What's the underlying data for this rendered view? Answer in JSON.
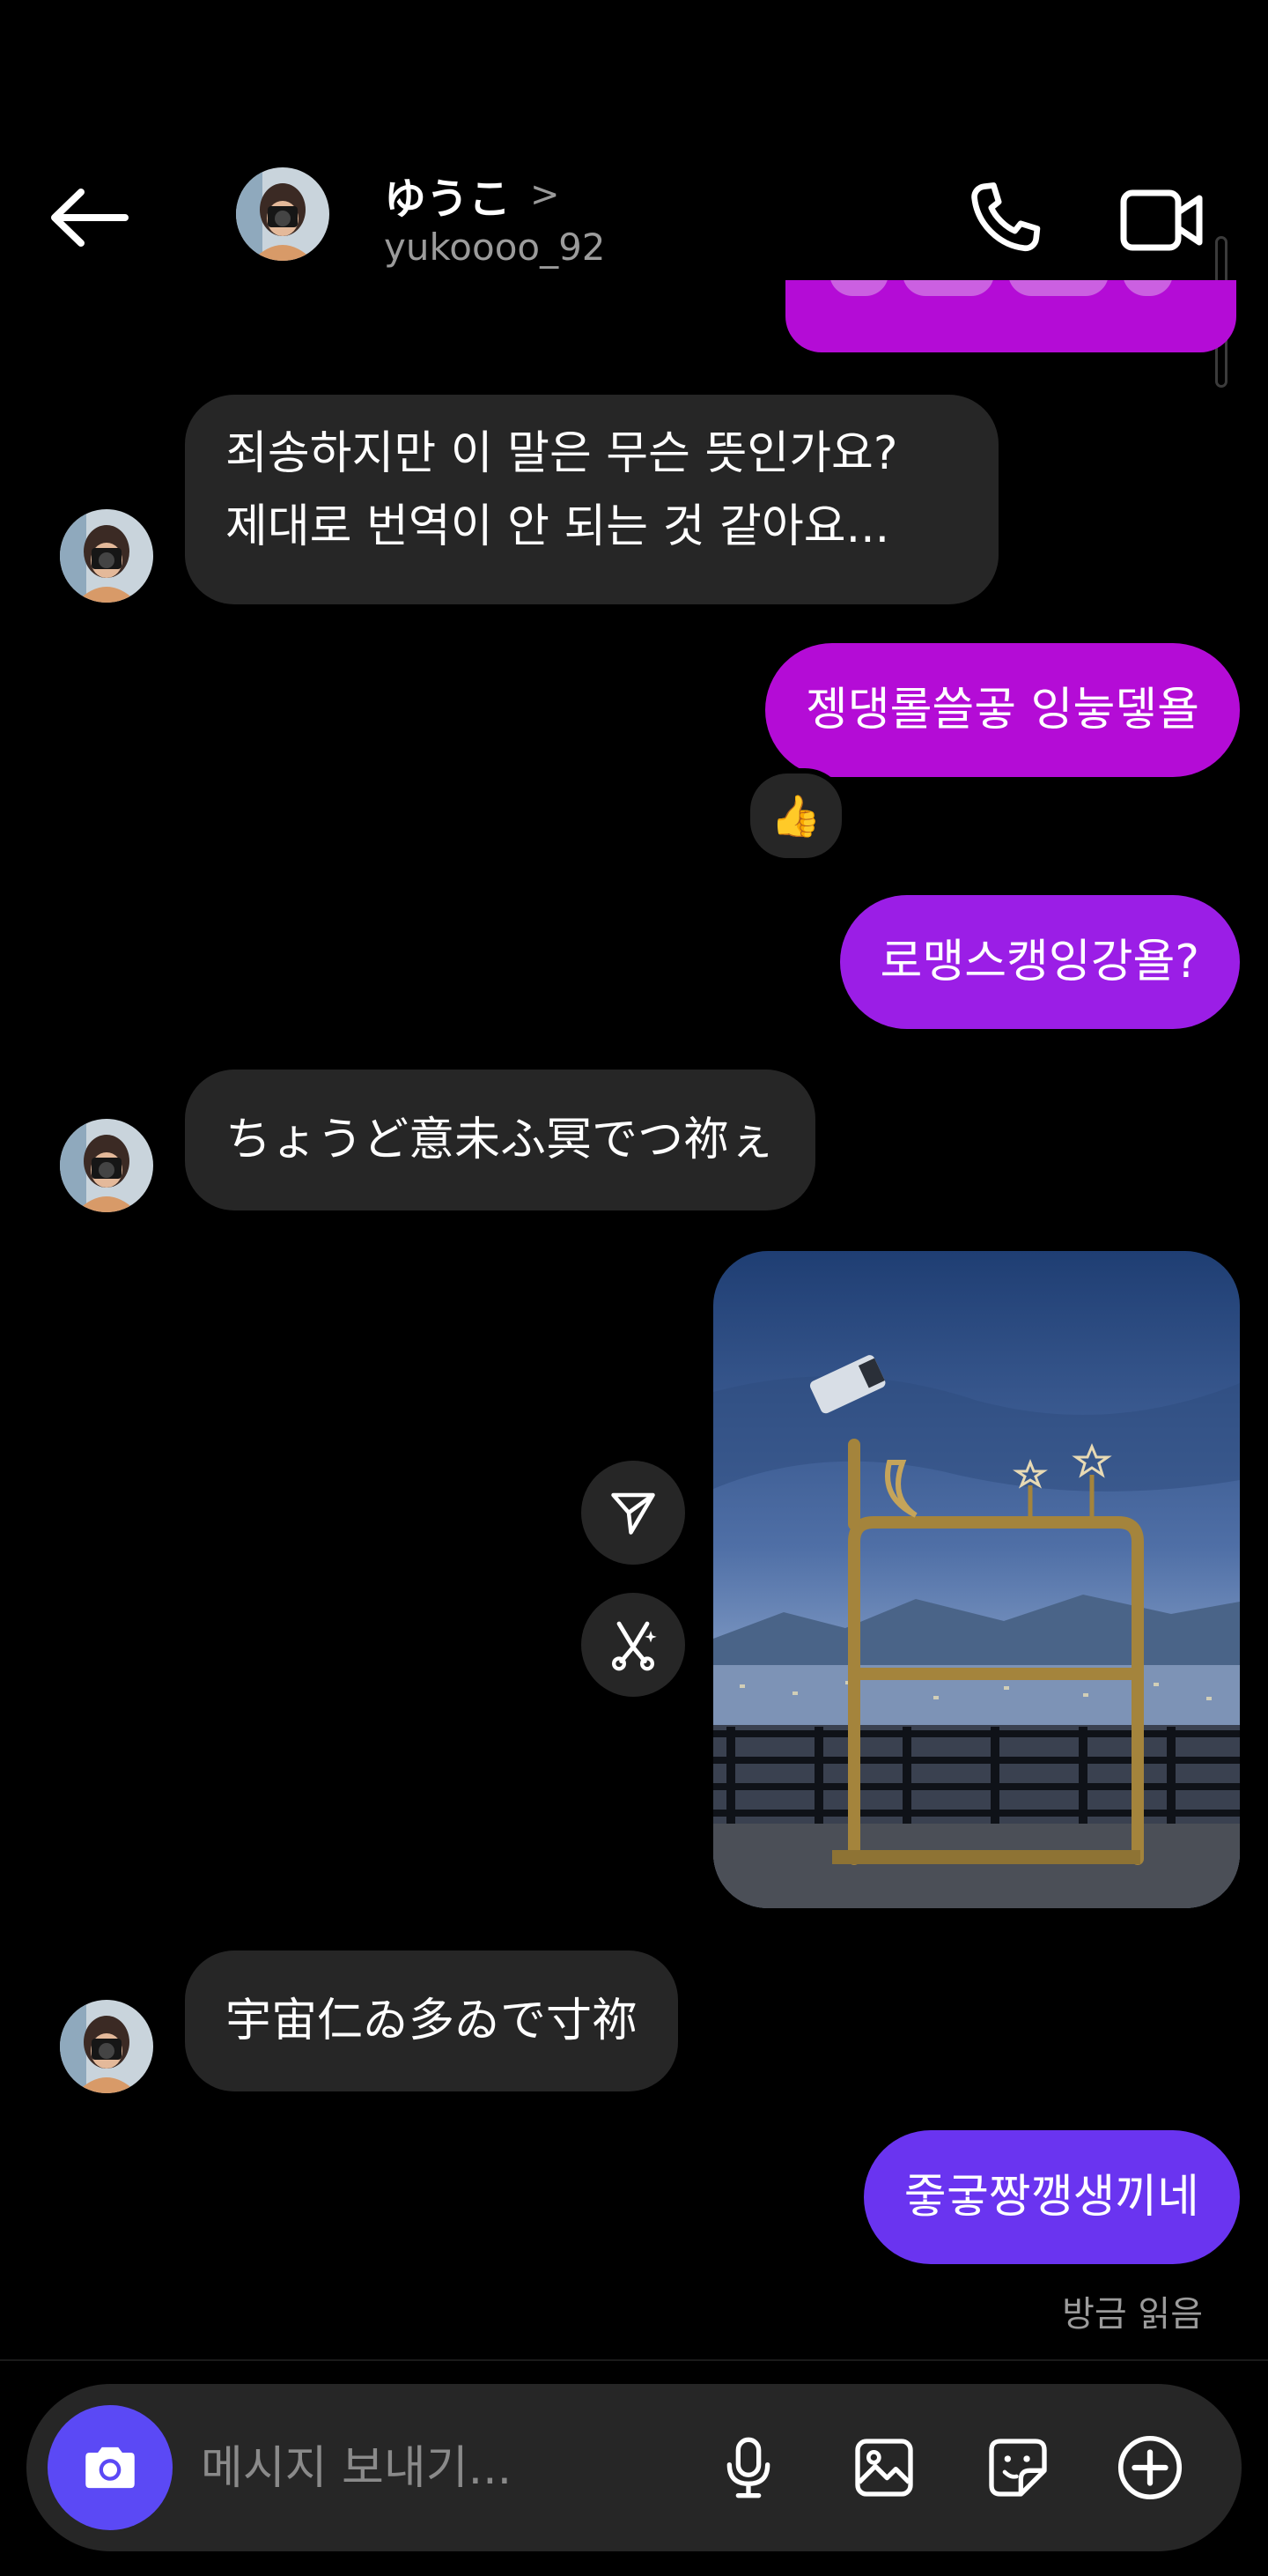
{
  "header": {
    "display_name": "ゆうこ",
    "chevron": ">",
    "username": "yukoooo_92"
  },
  "messages": {
    "m1": {
      "line1": "죄송하지만 이 말은 무슨 뜻인가요?",
      "line2": "제대로 번역이 안 되는 것 같아요..."
    },
    "m2": {
      "text": "젱댕롤쓸곻 잉늫뎋욜",
      "reaction": "👍"
    },
    "m3": {
      "text": "로맹스캥잉강욜?"
    },
    "m4": {
      "text": "ちょうど意未ふ冥でつ祢ぇ"
    },
    "m6": {
      "text": "宇宙仁ゐ多ゐで寸祢"
    },
    "m7": {
      "text": "줗궇짱깽생끼네"
    },
    "read_status": "방금 읽음"
  },
  "composer": {
    "placeholder": "메시지 보내기..."
  },
  "colors": {
    "background": "#000000",
    "incoming_bubble": "#262626",
    "outgoing_magenta": "#b40cd6",
    "outgoing_purple": "#9b1ee6",
    "outgoing_violet": "#6a34f0",
    "camera_button": "#5b49f5",
    "secondary_text": "#9b9b9b"
  },
  "icons": [
    "back-arrow-icon",
    "chevron-right-icon",
    "phone-icon",
    "video-camera-icon",
    "thumbs-up-icon",
    "send-icon",
    "remix-icon",
    "camera-icon",
    "microphone-icon",
    "gallery-icon",
    "sticker-icon",
    "plus-circle-icon"
  ]
}
